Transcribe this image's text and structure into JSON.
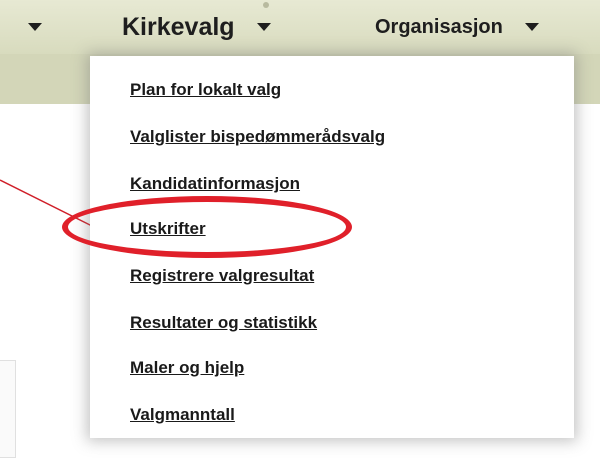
{
  "nav": {
    "primary_label": "Kirkevalg",
    "secondary_label": "Organisasjon",
    "left_arrow_icon": "caret-down-icon",
    "arrow_icon": "caret-down-icon"
  },
  "dropdown": {
    "items": [
      {
        "label": "Plan for lokalt valg"
      },
      {
        "label": "Valglister bispedømmerådsvalg"
      },
      {
        "label": "Kandidatinformasjon"
      },
      {
        "label": "Utskrifter",
        "highlighted": true
      },
      {
        "label": "Registrere valgresultat"
      },
      {
        "label": "Resultater og statistikk"
      },
      {
        "label": "Maler og hjelp"
      },
      {
        "label": "Valgmanntall"
      }
    ]
  },
  "annotation": {
    "highlight_color": "#e0202a"
  },
  "colors": {
    "bar": "#d8dbbe",
    "text": "#1a1a1a"
  }
}
